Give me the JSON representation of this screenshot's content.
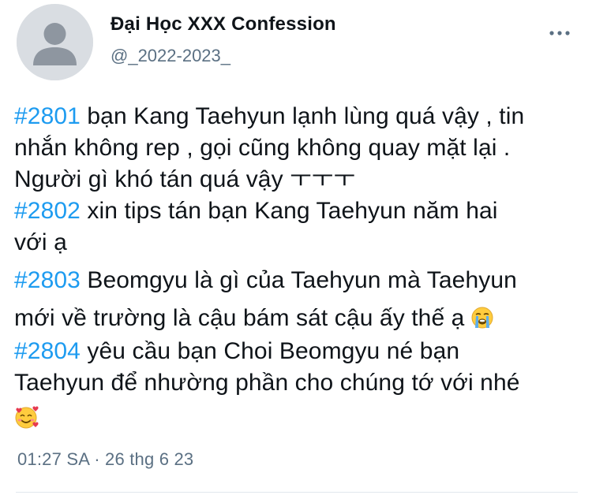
{
  "author": {
    "display_name": "Đại Học XXX Confession",
    "handle": "@_2022-2023_"
  },
  "more_icon": "more-horizontal-icon",
  "tweet": {
    "lines": [
      {
        "tag": "#2801",
        "text": " bạn Kang Taehyun lạnh lùng quá vậy , tin"
      },
      {
        "text": "nhắn không rep , gọi cũng không quay mặt lại ."
      },
      {
        "text": "Người gì khó tán quá vậy ㅜㅜㅜ"
      },
      {
        "tag": "#2802",
        "text": " xin tips tán bạn Kang Taehyun năm hai"
      },
      {
        "text": "với ạ"
      },
      {
        "tag": "#2803",
        "text": " Beomgyu là gì của Taehyun mà Taehyun"
      },
      {
        "text": "mới về trường là cậu bám sát cậu ấy thế ạ",
        "emoji": "loudly-crying-face-icon"
      },
      {
        "tag": "#2804",
        "text": " yêu cầu bạn Choi Beomgyu né bạn"
      },
      {
        "text": "Taehyun để nhường phần cho chúng tớ với nhé"
      },
      {
        "emoji_only": "smiling-face-with-hearts-icon"
      }
    ]
  },
  "timestamp": "01:27 SA · 26 thg 6 23",
  "colors": {
    "hashtag": "#1d9bf0",
    "secondary_text": "#5b7083",
    "primary_text": "#0f1419",
    "divider": "#e1e8ed"
  }
}
